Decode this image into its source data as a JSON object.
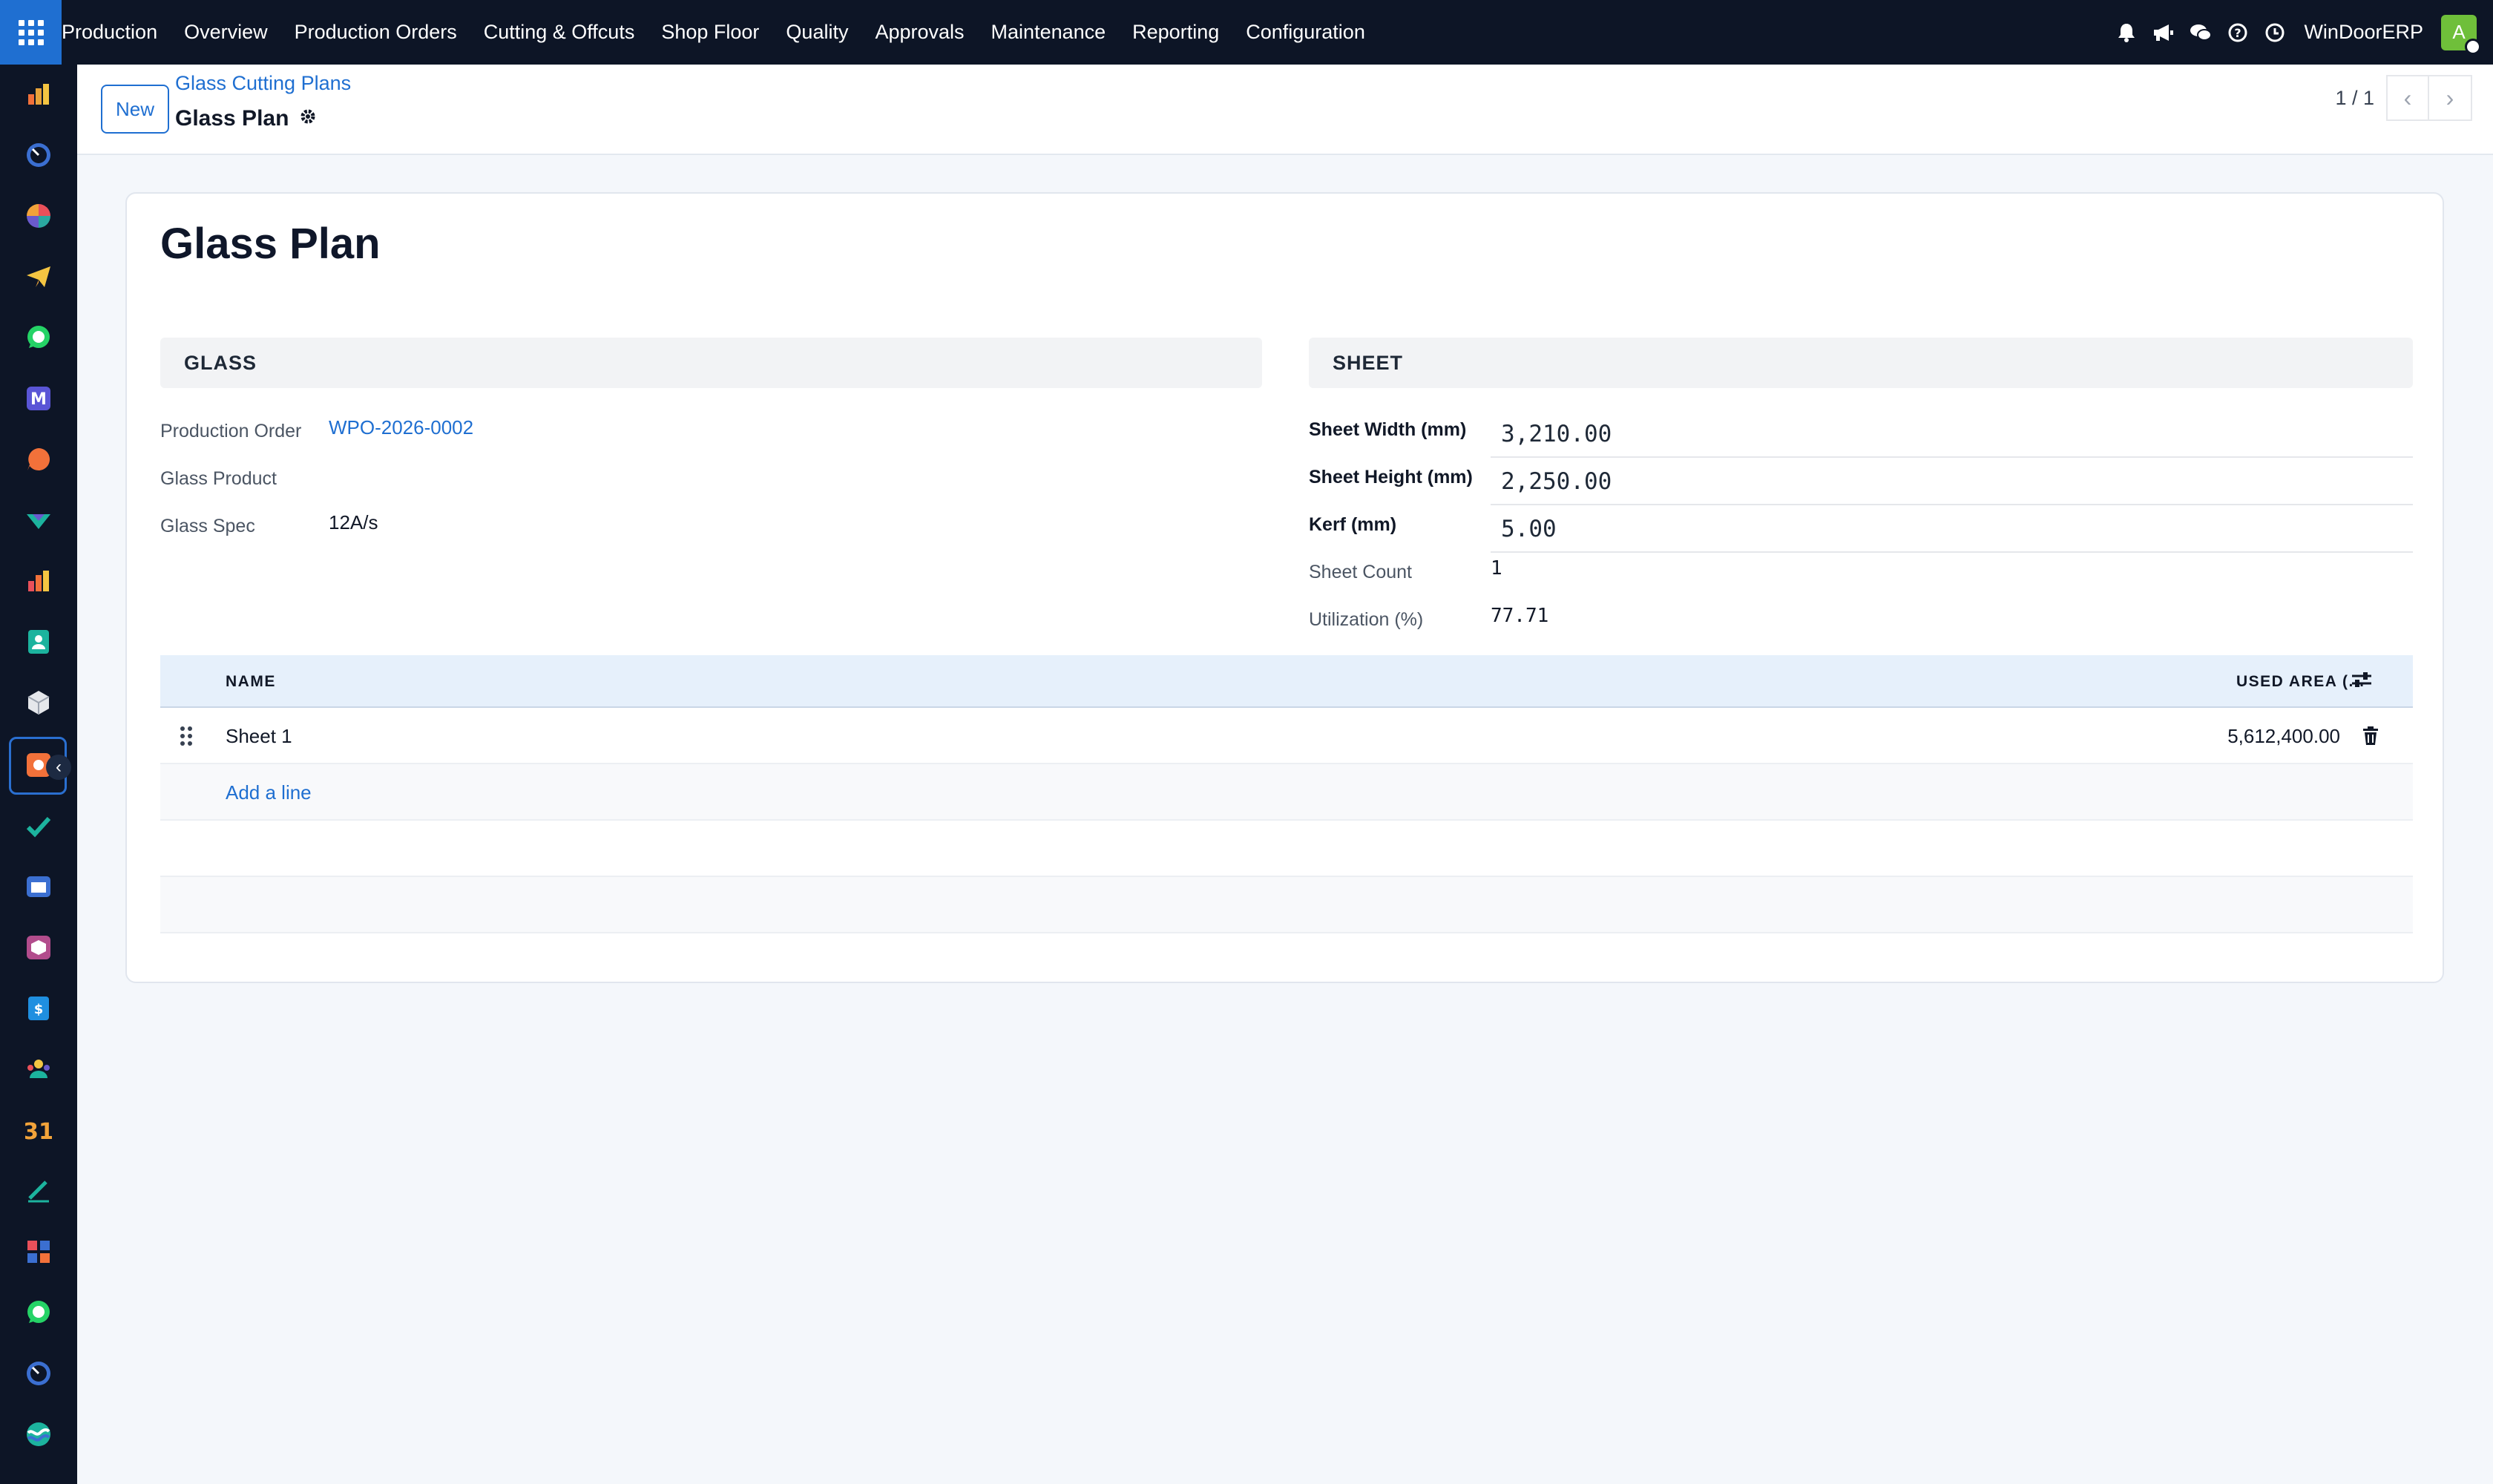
{
  "navbar": {
    "brand": "Production",
    "menu": [
      "Overview",
      "Production Orders",
      "Cutting & Offcuts",
      "Shop Floor",
      "Quality",
      "Approvals",
      "Maintenance",
      "Reporting",
      "Configuration"
    ],
    "company": "WinDoorERP",
    "avatar_letter": "A"
  },
  "control_panel": {
    "new_label": "New",
    "breadcrumb_parent": "Glass Cutting Plans",
    "breadcrumb_current": "Glass Plan",
    "pager": "1 / 1"
  },
  "form": {
    "title": "Glass Plan",
    "glass_section": {
      "heading": "GLASS",
      "production_order_label": "Production Order",
      "production_order_value": "WPO-2026-0002",
      "glass_product_label": "Glass Product",
      "glass_product_value": "",
      "glass_spec_label": "Glass Spec",
      "glass_spec_value": "12A/s"
    },
    "sheet_section": {
      "heading": "SHEET",
      "width_label": "Sheet Width (mm)",
      "width_value": "3,210.00",
      "height_label": "Sheet Height (mm)",
      "height_value": "2,250.00",
      "kerf_label": "Kerf (mm)",
      "kerf_value": "5.00",
      "count_label": "Sheet Count",
      "count_value": "1",
      "utilization_label": "Utilization (%)",
      "utilization_value": "77.71"
    },
    "lines_table": {
      "columns": {
        "name": "NAME",
        "used_area": "USED AREA (..."
      },
      "rows": [
        {
          "name": "Sheet 1",
          "used_area": "5,612,400.00"
        }
      ],
      "add_line_label": "Add a line"
    }
  },
  "colors": {
    "navbar_bg": "#0d1526",
    "accent": "#1f6fd1",
    "avatar": "#6fbf3a"
  }
}
